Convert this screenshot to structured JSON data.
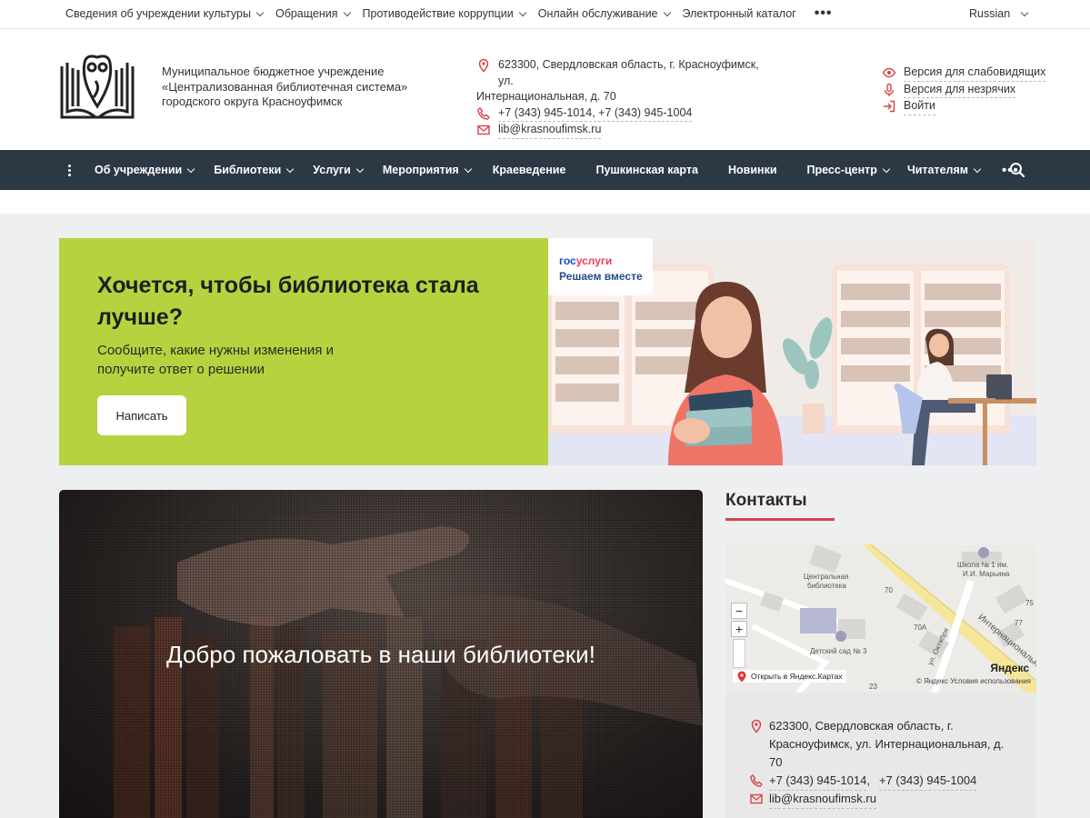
{
  "topbar": {
    "menu": [
      {
        "label": "Сведения об учреждении культуры",
        "dropdown": true
      },
      {
        "label": "Обращения",
        "dropdown": true
      },
      {
        "label": "Противодействие коррупции",
        "dropdown": true
      },
      {
        "label": "Онлайн обслуживание",
        "dropdown": true
      },
      {
        "label": "Электронный каталог",
        "dropdown": false
      }
    ],
    "more": "•••",
    "language": "Russian"
  },
  "header": {
    "org_line1": "Муниципальное бюджетное учреждение",
    "org_line2": "«Централизованная библиотечная система»",
    "org_line3": "городского округа Красноуфимск",
    "address_line1": "623300, Свердловская область, г. Красноуфимск, ул.",
    "address_line2": "Интернациональная, д. 70",
    "phones": "+7 (343) 945-1014, +7 (343) 945-1004",
    "email": "lib@krasnoufimsk.ru",
    "link_low_vision": "Версия для слабовидящих",
    "link_hearing": "Версия для незрячих",
    "link_login": "Войти"
  },
  "nav": {
    "items": [
      {
        "label": "Об учреждении",
        "dropdown": true
      },
      {
        "label": "Библиотеки",
        "dropdown": true
      },
      {
        "label": "Услуги",
        "dropdown": true
      },
      {
        "label": "Мероприятия",
        "dropdown": true
      },
      {
        "label": "Краеведение",
        "dropdown": false
      },
      {
        "label": "Пушкинская карта",
        "dropdown": false
      },
      {
        "label": "Новинки",
        "dropdown": false
      },
      {
        "label": "Пресс-центр",
        "dropdown": true
      },
      {
        "label": "Читателям",
        "dropdown": true
      }
    ],
    "more": "•••"
  },
  "banner": {
    "title": "Хочется, чтобы библиотека стала лучше?",
    "text": "Сообщите, какие нужны изменения и получите ответ о решении",
    "button": "Написать",
    "gos_part1": "гос",
    "gos_part2": "услуги",
    "gos_tagline": "Решаем вместе",
    "colors": {
      "left_bg": "#b5d33e",
      "gos_blue": "#0d4cd3",
      "gos_red": "#ee3f58"
    }
  },
  "welcome": {
    "title": "Добро пожаловать в наши библиотеки!"
  },
  "sidebar": {
    "title": "Контакты",
    "map": {
      "zoom_out": "−",
      "zoom_in": "+",
      "label_library_1": "Центральная",
      "label_library_2": "библиотека",
      "label_school_1": "Школа № 1 им.",
      "label_school_2": "И.И. Марьина",
      "label_kindergarten": "Детский сад № 3",
      "label_street_1": "Интернациональная",
      "label_street_2": "ул. Октября",
      "num_70": "70",
      "num_70a": "70А",
      "num_75": "75",
      "num_77": "77",
      "num_23": "23",
      "yandex": "Яндекс",
      "open_link": "Открыть в Яндекс.Картах",
      "copyright": "© Яндекс  Условия использования"
    },
    "address_line1": "623300, Свердловская область, г.",
    "address_line2": "Красноуфимск, ул. Интернациональная, д.",
    "address_line3": "70",
    "phone1": "+7 (343) 945-1014",
    "phone_sep": " ,",
    "phone2": "+7 (343) 945-1004",
    "email": "lib@krasnoufimsk.ru",
    "accent": "#d9434a"
  }
}
